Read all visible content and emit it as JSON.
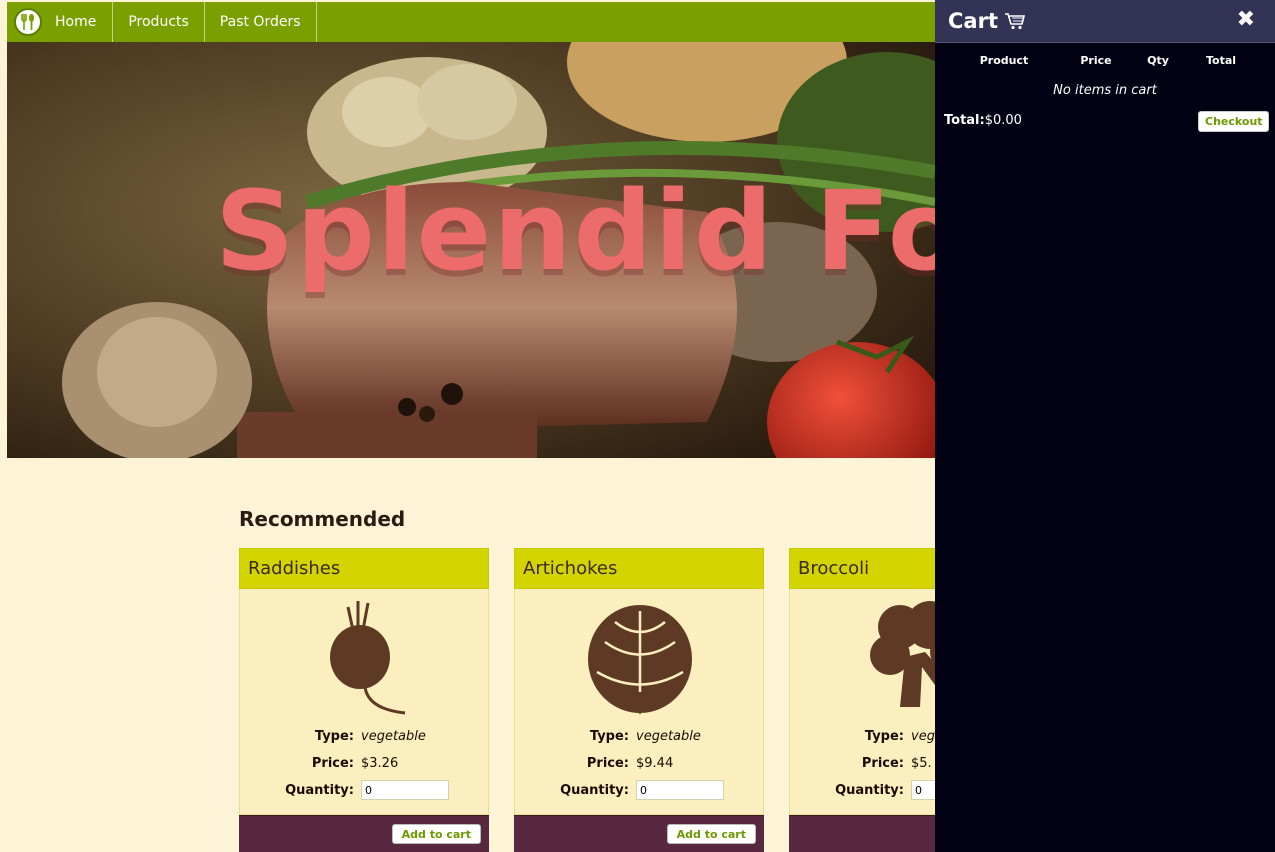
{
  "nav": {
    "items": [
      "Home",
      "Products",
      "Past Orders"
    ]
  },
  "hero": {
    "title": "Splendid Food"
  },
  "recommended": {
    "heading": "Recommended",
    "type_label": "Type:",
    "price_label": "Price:",
    "quantity_label": "Quantity:",
    "add_label": "Add to cart",
    "products": [
      {
        "name": "Raddishes",
        "type": "vegetable",
        "price": "$3.26",
        "quantity": "0",
        "icon": "radish-icon"
      },
      {
        "name": "Artichokes",
        "type": "vegetable",
        "price": "$9.44",
        "quantity": "0",
        "icon": "artichoke-icon"
      },
      {
        "name": "Broccoli",
        "type": "veg",
        "price": "$5.",
        "quantity": "0",
        "icon": "broccoli-icon"
      }
    ]
  },
  "cart": {
    "title": "Cart",
    "columns": [
      "Product",
      "Price",
      "Qty",
      "Total"
    ],
    "empty_message": "No items in cart",
    "total_label": "Total:",
    "total_value": "$0.00",
    "checkout_label": "Checkout"
  },
  "colors": {
    "nav": "#79a000",
    "card_head": "#d4d400",
    "card_body": "#fbefc0",
    "card_foot": "#57283f",
    "cart_bg": "#020214",
    "cart_header": "#333356",
    "hero_text": "#ec6b6b",
    "page_bg": "#fdf4d8"
  }
}
